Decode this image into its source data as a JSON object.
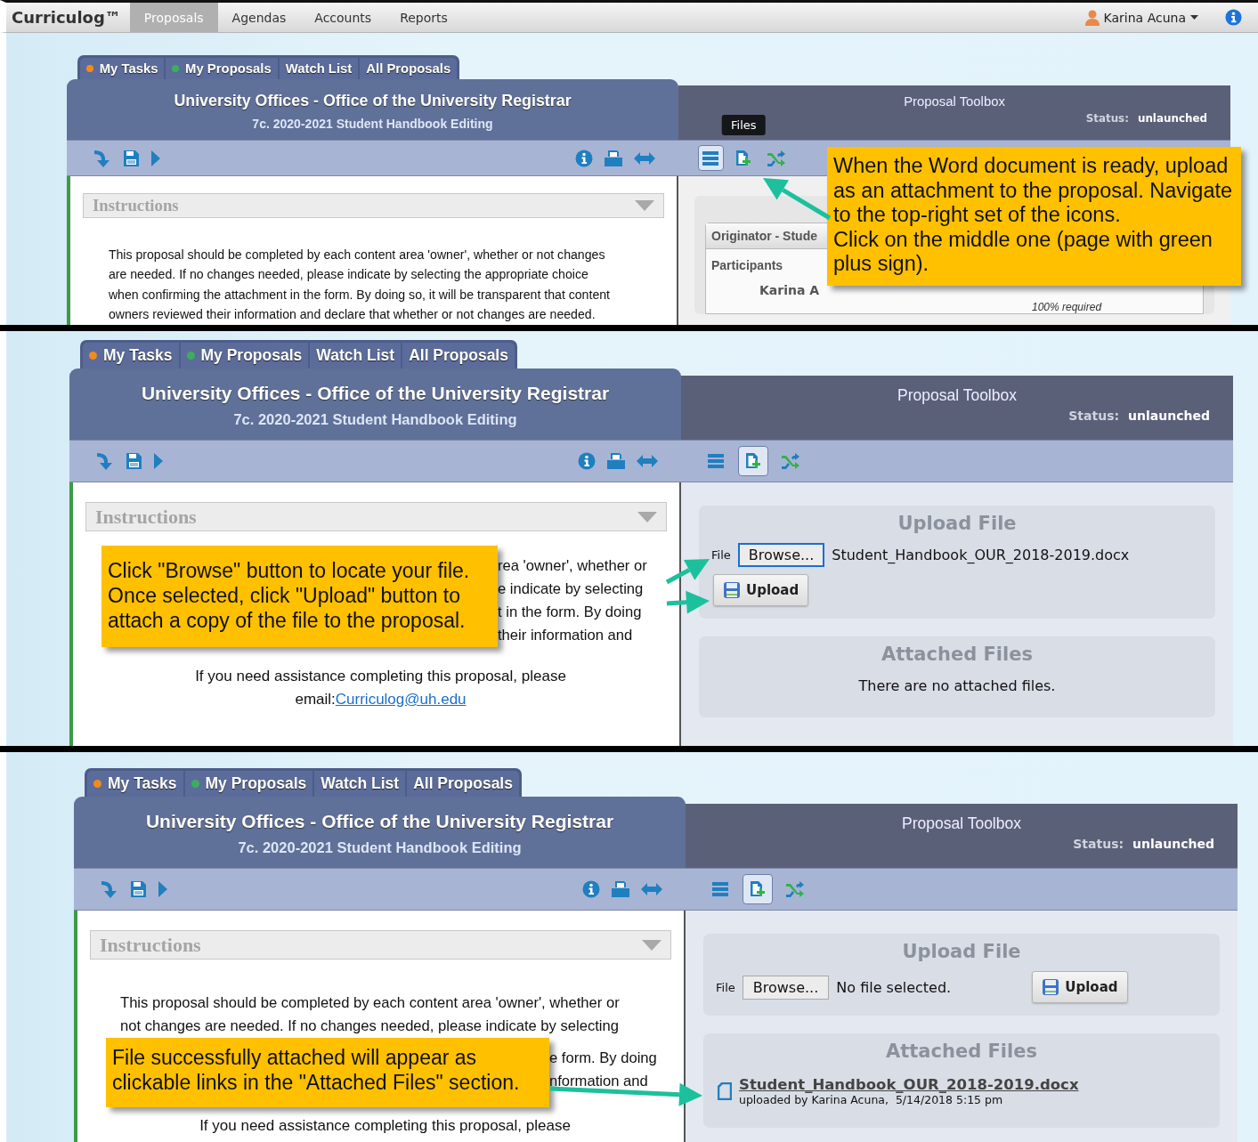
{
  "top_bar": {
    "logo": "Curriculog™",
    "nav": [
      {
        "label": "Proposals",
        "selected": true
      },
      {
        "label": "Agendas",
        "selected": false
      },
      {
        "label": "Accounts",
        "selected": false
      },
      {
        "label": "Reports",
        "selected": false
      }
    ],
    "user": "Karina Acuna"
  },
  "steps": [
    {
      "tabs": [
        {
          "label": "My Tasks",
          "color": "#f28a1c"
        },
        {
          "label": "My Proposals",
          "color": "#3cae5c"
        },
        {
          "label": "Watch List"
        },
        {
          "label": "All Proposals"
        }
      ],
      "card": {
        "title": "University Offices - Office of the University Registrar",
        "subtitle": "7c. 2020-2021 Student Handbook Editing"
      },
      "body": {
        "heading": "Instructions",
        "lines": [
          "This proposal should be completed by each content area 'owner', whether or not changes",
          "are needed. If no changes needed, please indicate by selecting the appropriate choice",
          "when confirming the attachment in the form. By doing so, it will be transparent that content",
          "owners reviewed their information and declare that whether or not changes are needed."
        ]
      },
      "toolbox": {
        "title": "Proposal Toolbox",
        "status_label": "Status:",
        "status": "unlaunched",
        "tools": [
          {
            "kind": "list",
            "selected": true
          },
          {
            "kind": "files",
            "selected": false,
            "tooltip": "Files"
          },
          {
            "kind": "shuffle",
            "selected": false
          }
        ],
        "content": {
          "kind": "participants",
          "group": "Originator - Stude",
          "label": "Participants",
          "name": "Karina A",
          "requirement": "100% required"
        }
      },
      "callout": {
        "kind": "overlay",
        "text": "When the Word document is ready, upload as an attachment to the proposal. Navigate to the top-right set of the icons.\nClick on the middle one (page with green plus sign)."
      }
    },
    {
      "tabs": [
        {
          "label": "My Tasks",
          "color": "#f28a1c"
        },
        {
          "label": "My Proposals",
          "color": "#3cae5c"
        },
        {
          "label": "Watch List"
        },
        {
          "label": "All Proposals"
        }
      ],
      "card": {
        "title": "University Offices - Office of the University Registrar",
        "subtitle": "7c. 2020-2021 Student Handbook Editing"
      },
      "body": {
        "heading": "Instructions",
        "fragments": [
          "rea 'owner', whether or",
          "e indicate by selecting",
          "t in the form. By doing",
          "their information and"
        ],
        "assistance": "If you need assistance completing this proposal, please",
        "email_prefix": "email:",
        "email": "Curriculog@uh.edu"
      },
      "toolbox": {
        "title": "Proposal Toolbox",
        "status_label": "Status:",
        "status": "unlaunched",
        "tools": [
          {
            "kind": "list",
            "selected": false
          },
          {
            "kind": "files",
            "selected": true
          },
          {
            "kind": "shuffle",
            "selected": false
          }
        ],
        "content": {
          "kind": "files",
          "upload": {
            "title": "Upload File",
            "file_label": "File",
            "browse": "Browse...",
            "browse_focused": true,
            "file_name": "Student_Handbook_OUR_2018-2019.docx",
            "button": "Upload"
          },
          "attached": {
            "title": "Attached Files",
            "empty": "There are no attached files."
          }
        }
      },
      "callout": {
        "kind": "inline",
        "text": "Click \"Browse\" button to locate your file.\nOnce selected, click \"Upload\" button to\nattach a copy of the file to the proposal."
      }
    },
    {
      "tabs": [
        {
          "label": "My Tasks",
          "color": "#f28a1c"
        },
        {
          "label": "My Proposals",
          "color": "#3cae5c"
        },
        {
          "label": "Watch List"
        },
        {
          "label": "All Proposals"
        }
      ],
      "card": {
        "title": "University Offices - Office of the University Registrar",
        "subtitle": "7c. 2020-2021 Student Handbook Editing"
      },
      "body": {
        "heading": "Instructions",
        "lines": [
          "This proposal should be completed by each content area 'owner', whether or",
          "not changes are needed. If no changes needed, please indicate by selecting"
        ],
        "fragments": [
          "e form. By doing",
          "nformation and"
        ],
        "assistance": "If you need assistance completing this proposal, please"
      },
      "toolbox": {
        "title": "Proposal Toolbox",
        "status_label": "Status:",
        "status": "unlaunched",
        "tools": [
          {
            "kind": "list",
            "selected": false
          },
          {
            "kind": "files",
            "selected": true
          },
          {
            "kind": "shuffle",
            "selected": false
          }
        ],
        "content": {
          "kind": "files",
          "upload": {
            "title": "Upload File",
            "file_label": "File",
            "browse": "Browse...",
            "browse_focused": false,
            "file_name": "No file selected.",
            "button": "Upload"
          },
          "attached": {
            "title": "Attached Files",
            "files": [
              {
                "name": "Student_Handbook_OUR_2018-2019.docx",
                "meta": "uploaded by Karina Acuna,  5/14/2018 5:15 pm"
              }
            ]
          }
        }
      },
      "callout": {
        "kind": "inline",
        "text": "File successfully attached will appear as\nclickable links in the \"Attached Files\" section."
      }
    }
  ]
}
